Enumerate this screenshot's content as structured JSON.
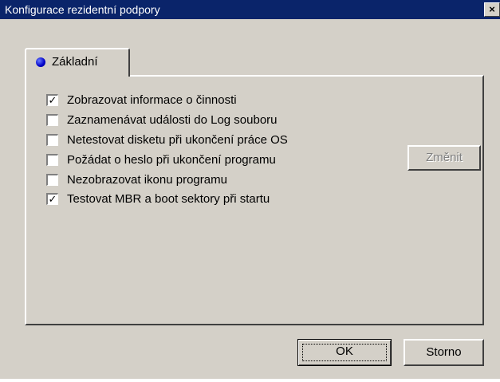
{
  "window": {
    "title": "Konfigurace rezidentní podpory",
    "close_glyph": "×"
  },
  "tab": {
    "label": "Základní",
    "icon": "blue-dot-icon",
    "icon_color": "#0000c8"
  },
  "options": [
    {
      "label": "Zobrazovat informace o činnosti",
      "checked": true
    },
    {
      "label": "Zaznamenávat události do Log souboru",
      "checked": false
    },
    {
      "label": "Netestovat disketu při ukončení práce OS",
      "checked": false
    },
    {
      "label": "Požádat o heslo při ukončení programu",
      "checked": false
    },
    {
      "label": "Nezobrazovat ikonu programu",
      "checked": false
    },
    {
      "label": "Testovat MBR a boot sektory při startu",
      "checked": true
    }
  ],
  "buttons": {
    "change": "Změnit",
    "ok": "OK",
    "cancel": "Storno"
  },
  "colors": {
    "titlebar": "#0a246a",
    "face": "#d4d0c8"
  }
}
